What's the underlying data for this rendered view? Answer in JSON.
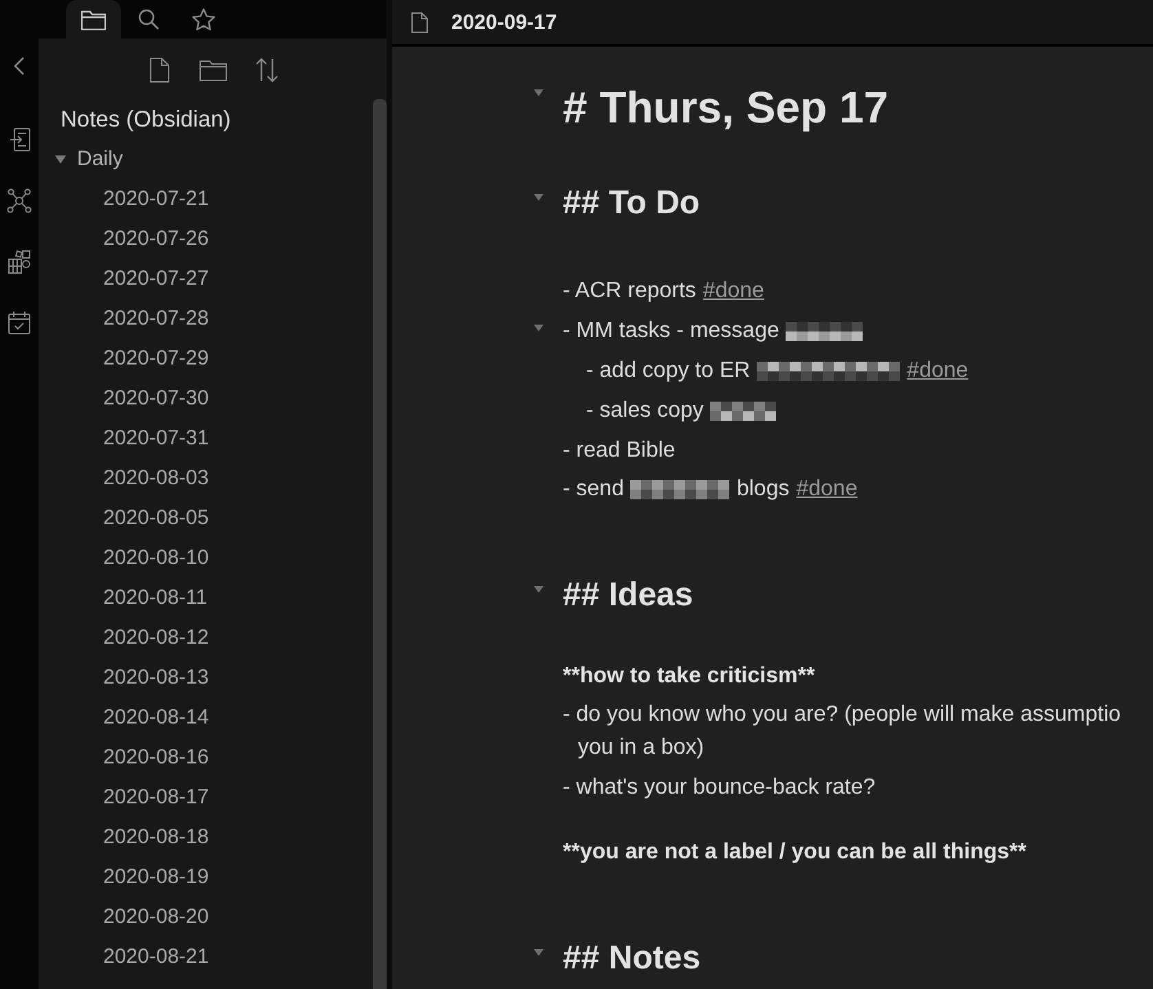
{
  "sidebar": {
    "tabs": [
      {
        "selected": true
      },
      {
        "selected": false
      },
      {
        "selected": false
      }
    ],
    "vault_name": "Notes (Obsidian)",
    "tree": [
      {
        "label": "Daily",
        "expanded": true,
        "children": [
          {
            "label": "2020-07-21"
          },
          {
            "label": "2020-07-26"
          },
          {
            "label": "2020-07-27"
          },
          {
            "label": "2020-07-28"
          },
          {
            "label": "2020-07-29"
          },
          {
            "label": "2020-07-30"
          },
          {
            "label": "2020-07-31"
          },
          {
            "label": "2020-08-03"
          },
          {
            "label": "2020-08-05"
          },
          {
            "label": "2020-08-10"
          },
          {
            "label": "2020-08-11"
          },
          {
            "label": "2020-08-12"
          },
          {
            "label": "2020-08-13"
          },
          {
            "label": "2020-08-14"
          },
          {
            "label": "2020-08-16"
          },
          {
            "label": "2020-08-17"
          },
          {
            "label": "2020-08-18"
          },
          {
            "label": "2020-08-19"
          },
          {
            "label": "2020-08-20"
          },
          {
            "label": "2020-08-21"
          }
        ]
      }
    ]
  },
  "editor": {
    "title": "2020-09-17",
    "blocks": [
      {
        "kind": "heading1",
        "text": "# Thurs, Sep 17"
      },
      {
        "kind": "heading2",
        "text": "## To Do"
      },
      {
        "kind": "list",
        "items": [
          {
            "parts": [
              {
                "kind": "text",
                "text": "- ACR reports"
              },
              {
                "kind": "tag",
                "text": "#done"
              }
            ]
          },
          {
            "parts": [
              {
                "kind": "text",
                "text": "- MM tasks - message"
              },
              {
                "kind": "redaction"
              }
            ],
            "children": [
              {
                "parts": [
                  {
                    "kind": "text",
                    "text": "- add copy to ER"
                  },
                  {
                    "kind": "redaction"
                  },
                  {
                    "kind": "tag",
                    "text": "#done"
                  }
                ]
              },
              {
                "parts": [
                  {
                    "kind": "text",
                    "text": "- sales copy"
                  },
                  {
                    "kind": "redaction"
                  }
                ]
              }
            ]
          },
          {
            "parts": [
              {
                "kind": "text",
                "text": "- read Bible"
              }
            ]
          },
          {
            "parts": [
              {
                "kind": "text",
                "text": "- send"
              },
              {
                "kind": "redaction"
              },
              {
                "kind": "text",
                "text": "blogs"
              },
              {
                "kind": "tag",
                "text": "#done"
              }
            ]
          }
        ]
      },
      {
        "kind": "heading2",
        "text": "## Ideas"
      },
      {
        "kind": "bold",
        "text": "**how to take criticism**"
      },
      {
        "kind": "list",
        "items": [
          {
            "lines": [
              "- do you know who you are? (people will make assumptio",
              "you in a box)"
            ]
          },
          {
            "parts": [
              {
                "kind": "text",
                "text": "- what's your bounce-back rate?"
              }
            ]
          }
        ]
      },
      {
        "kind": "bold",
        "text": "**you are not a label / you can be all things**"
      },
      {
        "kind": "heading2",
        "text": "## Notes"
      }
    ]
  }
}
